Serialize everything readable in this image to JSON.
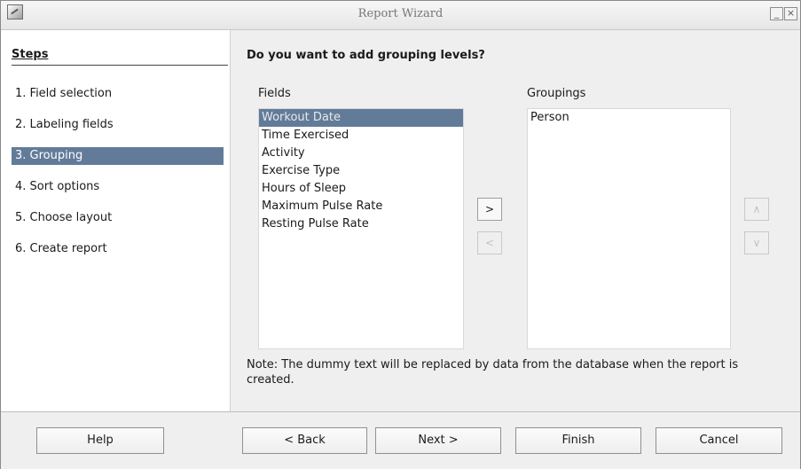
{
  "window": {
    "title": "Report Wizard",
    "minimize": "_",
    "close": "×"
  },
  "sidebar": {
    "title": "Steps",
    "items": [
      {
        "label": "1. Field selection"
      },
      {
        "label": "2. Labeling fields"
      },
      {
        "label": "3. Grouping"
      },
      {
        "label": "4. Sort options"
      },
      {
        "label": "5. Choose layout"
      },
      {
        "label": "6. Create report"
      }
    ]
  },
  "main": {
    "question": "Do you want to add grouping levels?",
    "fields_label": "Fields",
    "fields_label_underline": "l",
    "groupings_label": "Groupings",
    "groupings_label_underline": "u",
    "fields": [
      "Workout Date",
      "Time Exercised",
      "Activity",
      "Exercise Type",
      "Hours of Sleep",
      "Maximum Pulse Rate",
      "Resting Pulse Rate"
    ],
    "selected_field": "Workout Date",
    "groupings": [
      "Person"
    ],
    "add_button": ">",
    "remove_button": "<",
    "up_button": "∧",
    "down_button": "∨",
    "note": "Note: The dummy text will be replaced by data from the database when the report is created."
  },
  "footer": {
    "help": "Help",
    "back": "< Back",
    "next": "Next >",
    "finish": "Finish",
    "cancel": "Cancel"
  }
}
